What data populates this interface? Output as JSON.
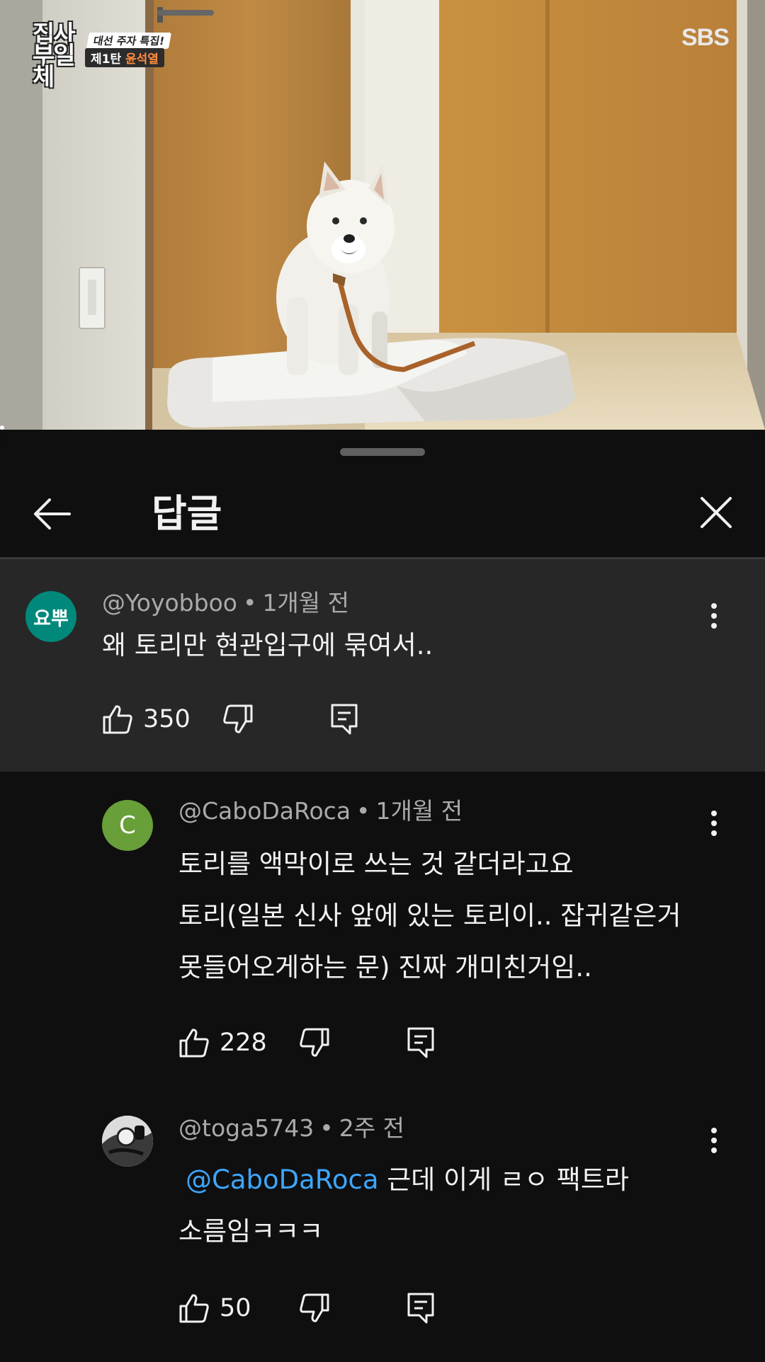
{
  "video": {
    "show_title": "집사부일체",
    "banner_line1": "대선 주자 특집!",
    "banner_prefix": "제1탄",
    "banner_name": "윤석열",
    "channel_logo": "SBS"
  },
  "header": {
    "back_icon": "arrow-left-icon",
    "title": "답글",
    "close_icon": "close-icon"
  },
  "comments": [
    {
      "avatar_text": "요뿌",
      "avatar_color": "#00897b",
      "author": "@Yoyobboo",
      "separator": "•",
      "time": "1개월 전",
      "lines": [
        "왜 토리만 현관입구에 묶여서.."
      ],
      "likes": "350"
    },
    {
      "avatar_text": "C",
      "avatar_color": "#689f38",
      "author": "@CaboDaRoca",
      "separator": "•",
      "time": "1개월 전",
      "lines": [
        "토리를 액막이로 쓰는 것 같더라고요",
        "토리(일본 신사 앞에 있는 토리이.. 잡귀같은거",
        "못들어오게하는 문) 진짜 개미친거임.."
      ],
      "likes": "228"
    },
    {
      "avatar_text": "",
      "avatar_color": "#e0e0e0",
      "author": "@toga5743",
      "separator": "•",
      "time": "2주 전",
      "mention": "@CaboDaRoca",
      "line1_rest": " 근데 이게 ㄹㅇ 팩트라",
      "line2": "소름임ㅋㅋㅋ",
      "likes": "50"
    }
  ]
}
